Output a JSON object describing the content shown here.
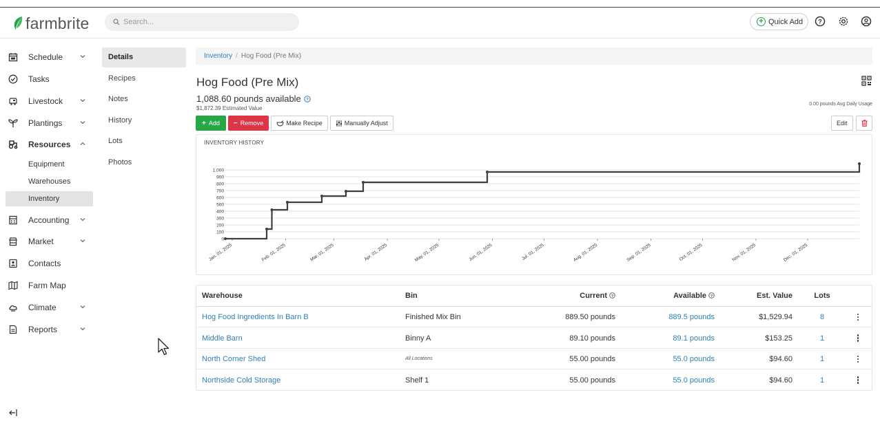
{
  "app": {
    "logo_text": "farmbrite",
    "brand_color": "#2a9d4a"
  },
  "search": {
    "placeholder": "Search..."
  },
  "header": {
    "quick_add_label": "Quick Add",
    "icons": [
      "help-icon",
      "settings-icon",
      "user-icon"
    ]
  },
  "sidebar": {
    "items": [
      {
        "label": "Schedule",
        "icon": "calendar-icon",
        "expandable": true
      },
      {
        "label": "Tasks",
        "icon": "check-circle-icon",
        "expandable": false
      },
      {
        "label": "Livestock",
        "icon": "cow-icon",
        "expandable": true
      },
      {
        "label": "Plantings",
        "icon": "sprout-icon",
        "expandable": true
      },
      {
        "label": "Resources",
        "icon": "tractor-icon",
        "expandable": true,
        "expanded": true
      },
      {
        "label": "Accounting",
        "icon": "calculator-icon",
        "expandable": true
      },
      {
        "label": "Market",
        "icon": "store-icon",
        "expandable": true
      },
      {
        "label": "Contacts",
        "icon": "contact-icon",
        "expandable": false
      },
      {
        "label": "Farm Map",
        "icon": "map-icon",
        "expandable": false
      },
      {
        "label": "Climate",
        "icon": "cloud-icon",
        "expandable": true
      },
      {
        "label": "Reports",
        "icon": "report-icon",
        "expandable": true
      }
    ],
    "resources_sub": [
      "Equipment",
      "Warehouses",
      "Inventory"
    ],
    "active_sub": "Inventory"
  },
  "subtabs": [
    "Details",
    "Recipes",
    "Notes",
    "History",
    "Lots",
    "Photos"
  ],
  "breadcrumb": {
    "parent": "Inventory",
    "current": "Hog Food (Pre Mix)"
  },
  "item": {
    "title": "Hog Food (Pre Mix)",
    "available": "1,088.60 pounds available",
    "estimated_value": "$1,872.39 Estimated Value",
    "usage": "0.00 pounds Avg Daily Usage"
  },
  "actions": {
    "add": "Add",
    "remove": "Remove",
    "make_recipe": "Make Recipe",
    "manually_adjust": "Manually Adjust",
    "edit": "Edit"
  },
  "chart_data": {
    "type": "line",
    "title": "INVENTORY HISTORY",
    "step": true,
    "x_ticks": [
      "Jan. 01, 2025",
      "Feb. 01, 2025",
      "Mar. 01, 2025",
      "Apr. 01, 2025",
      "May. 01, 2025",
      "Jun. 01, 2025",
      "Jul. 01, 2025",
      "Aug. 01, 2025",
      "Sep. 01, 2025",
      "Oct. 01, 2025",
      "Nov. 01, 2025",
      "Dec. 01, 2025"
    ],
    "y_ticks": [
      "0",
      "100",
      "200",
      "300",
      "400",
      "500",
      "600",
      "700",
      "800",
      "900",
      "1,000"
    ],
    "ylim": [
      0,
      1100
    ],
    "xlim": [
      "2024-12-28",
      "2025-12-31"
    ],
    "grid": true,
    "series": [
      {
        "points": [
          {
            "x": "2024-12-28",
            "y": 0
          },
          {
            "x": "2025-01-21",
            "y": 140
          },
          {
            "x": "2025-01-24",
            "y": 420
          },
          {
            "x": "2025-02-02",
            "y": 530
          },
          {
            "x": "2025-02-22",
            "y": 620
          },
          {
            "x": "2025-03-08",
            "y": 690
          },
          {
            "x": "2025-03-18",
            "y": 820
          },
          {
            "x": "2025-05-29",
            "y": 970
          },
          {
            "x": "2025-12-31",
            "y": 1090
          }
        ]
      }
    ]
  },
  "table": {
    "headers": {
      "warehouse": "Warehouse",
      "bin": "Bin",
      "current": "Current",
      "available": "Available",
      "est_value": "Est. Value",
      "lots": "Lots"
    },
    "rows": [
      {
        "warehouse": "Hog Food Ingredients In Barn B",
        "bin": "Finished Mix Bin",
        "bin_style": "normal",
        "current": "889.50 pounds",
        "available": "889.5 pounds",
        "est_value": "$1,529.94",
        "lots": "8"
      },
      {
        "warehouse": "Middle Barn",
        "bin": "Binny A",
        "bin_style": "normal",
        "current": "89.10 pounds",
        "available": "89.1 pounds",
        "est_value": "$153.25",
        "lots": "1"
      },
      {
        "warehouse": "North Corner Shed",
        "bin": "All Locations",
        "bin_style": "italic",
        "current": "55.00 pounds",
        "available": "55.0 pounds",
        "est_value": "$94.60",
        "lots": "1"
      },
      {
        "warehouse": "Northside Cold Storage",
        "bin": "Shelf 1",
        "bin_style": "normal",
        "current": "55.00 pounds",
        "available": "55.0 pounds",
        "est_value": "$94.60",
        "lots": "1"
      }
    ]
  }
}
